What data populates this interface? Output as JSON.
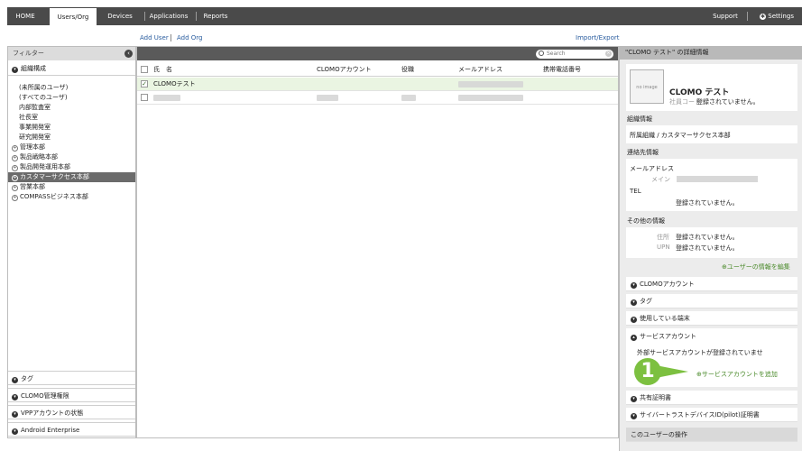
{
  "nav": {
    "tabs": [
      "HOME",
      "Users/Org",
      "Devices",
      "Applications",
      "Reports"
    ],
    "support": "Support",
    "settings": "Settings"
  },
  "actions": {
    "add_user": "Add User",
    "add_org": "Add Org",
    "import_export": "Import/Export"
  },
  "filter": {
    "title": "フィルター",
    "org_section": "組織構成",
    "org_items": [
      "(未所属のユーザ)",
      "(すべてのユーザ)",
      "内部監査室",
      "社長室",
      "事業開発室",
      "研究開発室"
    ],
    "org_groups": [
      "管理本部",
      "製品戦略本部",
      "製品開発運用本部",
      "カスタマーサクセス本部",
      "営業本部",
      "COMPASSビジネス本部"
    ],
    "bottom_sections": [
      "タグ",
      "CLOMO管理権限",
      "VPPアカウントの状態",
      "Android Enterprise"
    ]
  },
  "list": {
    "search_placeholder": "Search",
    "columns": [
      "氏　名",
      "CLOMOアカウント",
      "役職",
      "メールアドレス",
      "携帯電話番号"
    ],
    "rows": [
      {
        "name": "CLOMOテスト",
        "checked": true
      },
      {
        "name": "",
        "checked": false
      }
    ]
  },
  "detail": {
    "title": "\"CLOMO テスト\" の詳細情報",
    "no_image": "no image",
    "user_name": "CLOMO テスト",
    "employee_code_label": "社員コード",
    "employee_code_value": "登録されていません。",
    "org_info_title": "組織情報",
    "org_label": "所属組織 / カスタマーサクセス本部",
    "contact_title": "連絡先情報",
    "mail_label": "メールアドレス",
    "main_label": "メイン",
    "tel_label": "TEL",
    "tel_value": "登録されていません。",
    "other_title": "その他の情報",
    "address_label": "住所",
    "address_value": "登録されていません。",
    "upn_label": "UPN",
    "upn_value": "登録されていません。",
    "edit_link": "ユーザーの情報を編集",
    "sections": [
      "CLOMOアカウント",
      "タグ",
      "使用している端末",
      "サービスアカウント"
    ],
    "service_msg": "外部サービスアカウントが登録されていませ",
    "add_service": "サービスアカウントを追加",
    "sections2": [
      "共有証明書",
      "サイバートラストデバイスID(pilot)証明書",
      "このユーザーの操作"
    ]
  },
  "callout": "1"
}
